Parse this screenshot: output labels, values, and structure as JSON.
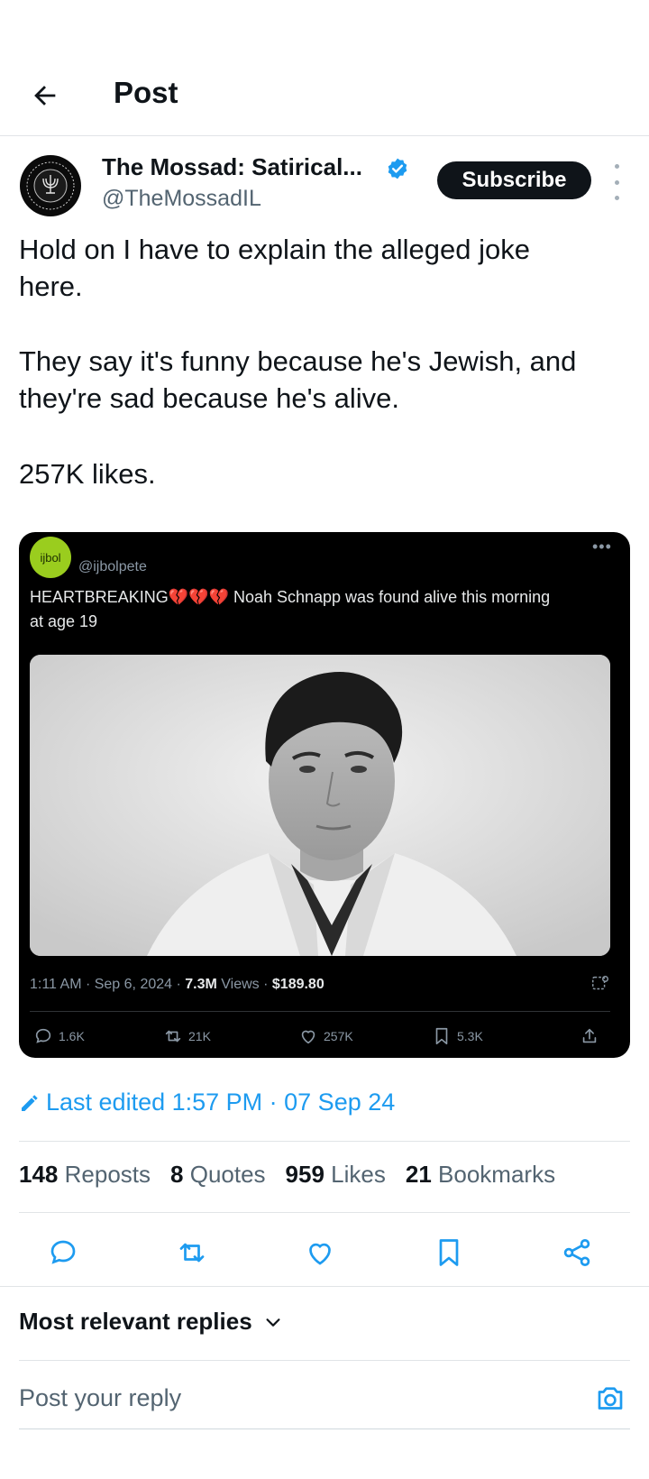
{
  "header": {
    "title": "Post"
  },
  "author": {
    "name": "The Mossad: Satirical...",
    "handle": "@TheMossadIL",
    "subscribe_label": "Subscribe"
  },
  "post": {
    "lines": [
      "Hold on I have to explain the alleged joke",
      "here.",
      "They say it's funny because he's Jewish, and",
      "they're sad because he's alive.",
      "257K likes."
    ]
  },
  "embed": {
    "avatar_text": "ijbol",
    "handle": "@ijbolpete",
    "text_prefix": "HEARTBREAKING",
    "text_suffix": "Noah Schnapp was found alive this morning",
    "text_line2": "at age 19",
    "meta_prefix": "1:11 AM · Sep 6, 2024 · ",
    "views_count": "7.3M",
    "views_label": " Views · ",
    "money": "$189.80",
    "actions": {
      "replies": "1.6K",
      "reposts": "21K",
      "likes": "257K",
      "bookmarks": "5.3K"
    }
  },
  "edited_label": "Last edited 1:57 PM · 07 Sep 24",
  "stats": {
    "reposts_count": "148",
    "reposts_label": "Reposts",
    "quotes_count": "8",
    "quotes_label": "Quotes",
    "likes_count": "959",
    "likes_label": "Likes",
    "bookmarks_count": "21",
    "bookmarks_label": "Bookmarks"
  },
  "replies": {
    "sort_label": "Most relevant replies",
    "placeholder": "Post your reply"
  },
  "colors": {
    "accent": "#1d9bf0",
    "text": "#0f1419",
    "muted": "#536471"
  }
}
